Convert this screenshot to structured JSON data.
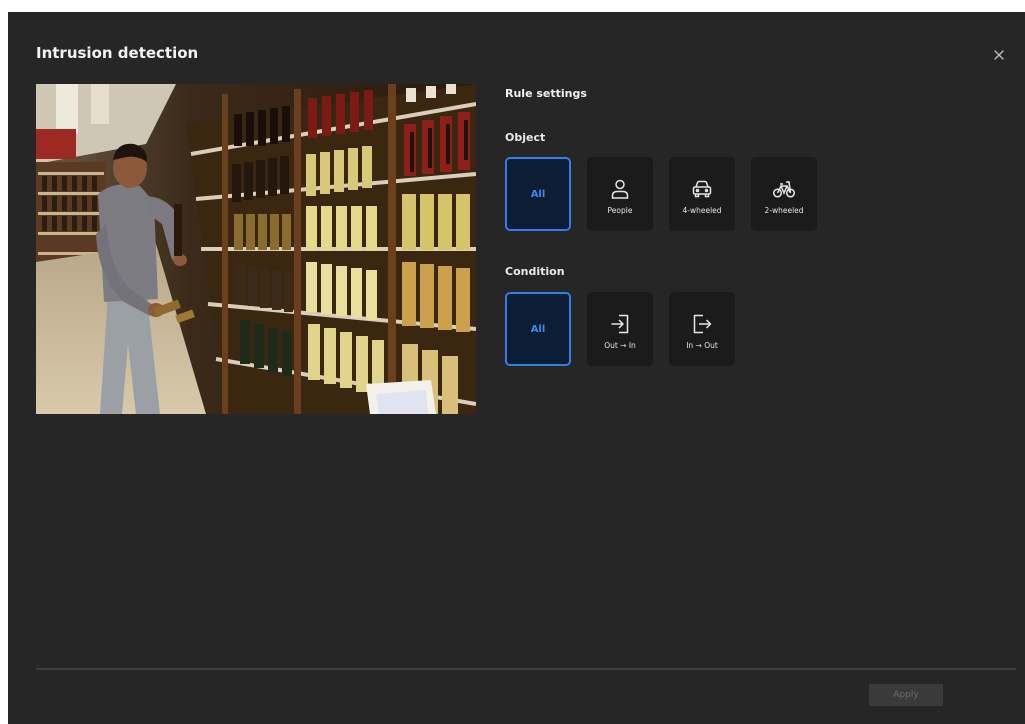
{
  "dialog": {
    "title": "Intrusion detection",
    "close_icon": "close-icon"
  },
  "preview": {
    "image": "camera-preview-supermarket-aisle"
  },
  "rule_settings": {
    "title": "Rule settings",
    "object": {
      "label": "Object",
      "selected": "All",
      "options": [
        {
          "label": "All",
          "icon": null
        },
        {
          "label": "People",
          "icon": "person-icon"
        },
        {
          "label": "4-wheeled",
          "icon": "car-icon"
        },
        {
          "label": "2-wheeled",
          "icon": "bicycle-icon"
        }
      ]
    },
    "condition": {
      "label": "Condition",
      "selected": "All",
      "options": [
        {
          "label": "All",
          "icon": null
        },
        {
          "label": "Out → In",
          "icon": "enter-icon"
        },
        {
          "label": "In → Out",
          "icon": "exit-icon"
        }
      ]
    }
  },
  "footer": {
    "apply_label": "Apply",
    "apply_enabled": false
  },
  "colors": {
    "background": "#262626",
    "accent": "#2f7fe8",
    "selected_fill": "#0d1d33",
    "option_fill": "#1b1b1b"
  }
}
